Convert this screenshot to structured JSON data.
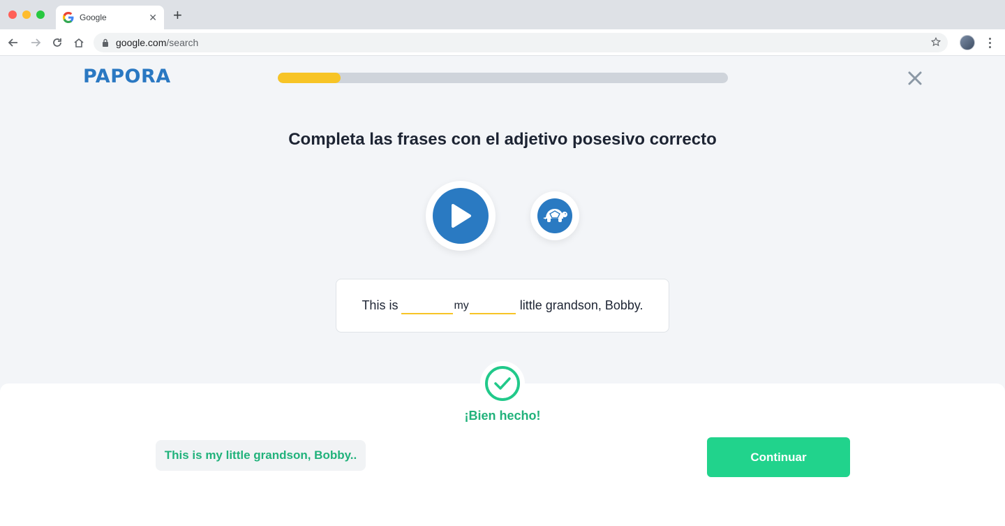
{
  "browser": {
    "tab_title": "Google",
    "url_host": "google.com",
    "url_path": "/search",
    "traffic_light_colors": [
      "#ff5f57",
      "#febc2e",
      "#28c840"
    ]
  },
  "app": {
    "logo": "PAPORA",
    "progress": 0.14,
    "colors": {
      "brand_blue": "#2a7ac2",
      "progress_yellow": "#f7c426",
      "success_green": "#21c98a",
      "button_green": "#21d38c"
    }
  },
  "exercise": {
    "heading": "Completa las frases con el adjetivo posesivo correcto",
    "sentence_before": "This is",
    "answer": "my",
    "sentence_after": "little grandson, Bobby."
  },
  "feedback": {
    "message": "¡Bien hecho!",
    "correct_sentence": "This is my little grandson, Bobby..",
    "continue_label": "Continuar"
  },
  "icons": {
    "play": "play-icon",
    "slow": "turtle-icon",
    "close": "close-icon",
    "check": "check-icon"
  }
}
